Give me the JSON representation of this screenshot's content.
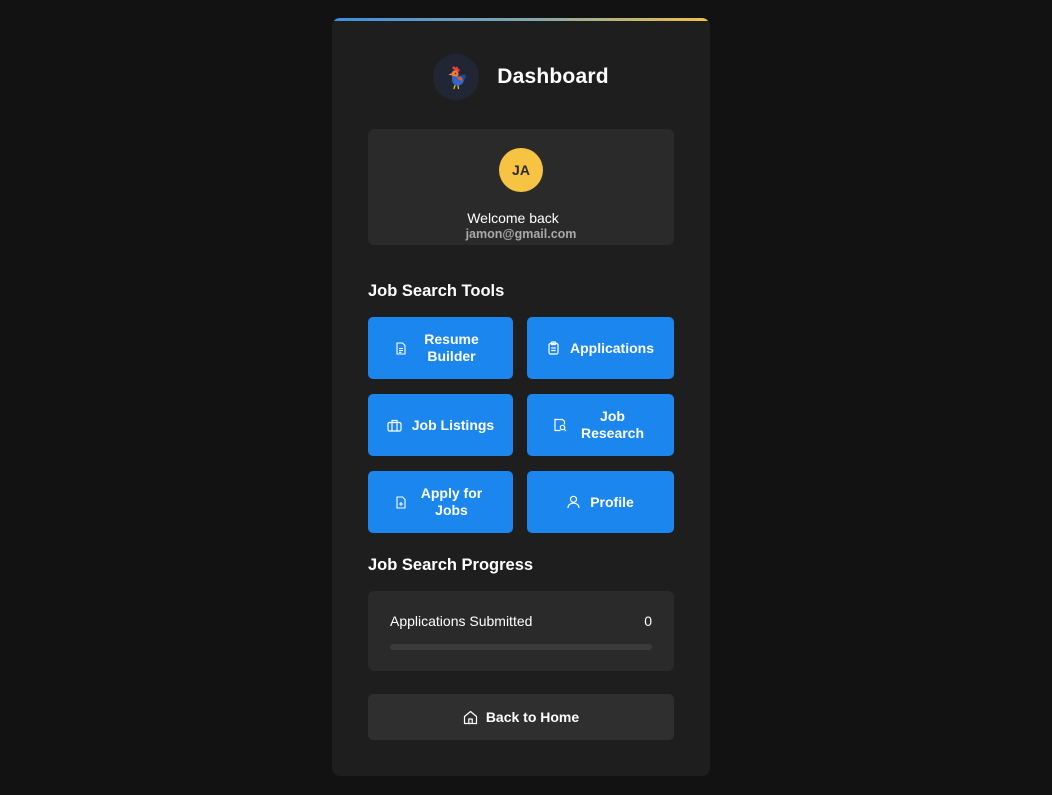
{
  "header": {
    "title": "Dashboard",
    "logo_icon": "rooster-icon"
  },
  "user": {
    "initials": "JA",
    "welcome": "Welcome back",
    "email": "jamon@gmail.com",
    "avatar_color": "#f6c343"
  },
  "tools": {
    "title": "Job Search Tools",
    "resume_builder": "Resume Builder",
    "applications": "Applications",
    "job_listings": "Job Listings",
    "job_research": "Job Research",
    "apply_for_jobs": "Apply for Jobs",
    "profile": "Profile",
    "button_color": "#1a86ee"
  },
  "progress": {
    "title": "Job Search Progress",
    "label": "Applications Submitted",
    "count": "0",
    "fraction": 0
  },
  "footer": {
    "back_home": "Back to Home"
  }
}
